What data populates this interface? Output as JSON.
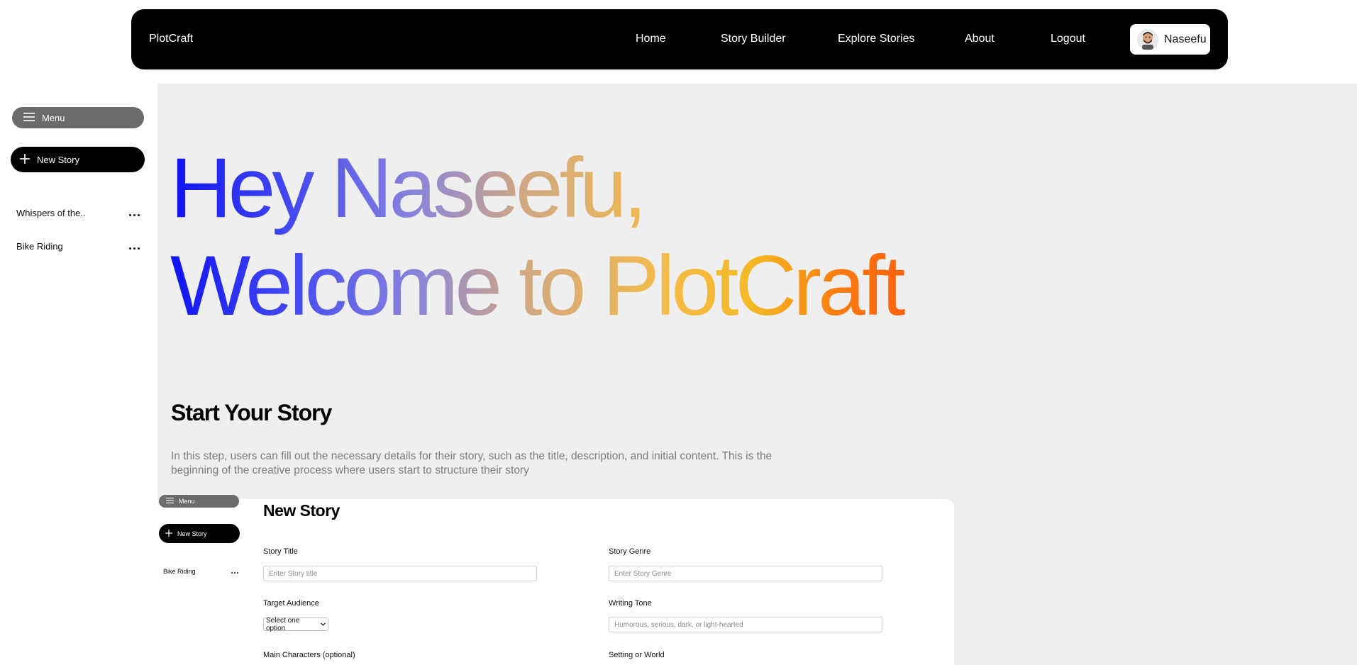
{
  "navbar": {
    "brand": "PlotCraft",
    "links": [
      "Home",
      "Story Builder",
      "Explore Stories",
      "About",
      "Logout"
    ],
    "user_name": "Naseefu"
  },
  "sidebar": {
    "menu_label": "Menu",
    "new_story_label": "New Story",
    "items": [
      {
        "label": "Whispers of the.."
      },
      {
        "label": "Bike Riding"
      }
    ]
  },
  "hero": {
    "line1": "Hey Naseefu,",
    "line2": "Welcome to PlotCraft",
    "gradient_colors": [
      "#0f14f5",
      "#8a84dc",
      "#f3bb4b",
      "#fd5c0c"
    ]
  },
  "start": {
    "title": "Start Your Story",
    "description": "In this step, users can fill out the necessary details for their story, such as the title, description, and initial content. This is the beginning of the creative process where users start to structure their story"
  },
  "form": {
    "mini_sidebar": {
      "menu_label": "Menu",
      "new_story_label": "New Story",
      "items": [
        {
          "label": "Bike Riding"
        }
      ]
    },
    "title": "New Story",
    "fields": {
      "story_title": {
        "label": "Story Title",
        "placeholder": "Enter Story title"
      },
      "story_genre": {
        "label": "Story Genre",
        "placeholder": "Enter Story Genre"
      },
      "target_audience": {
        "label": "Target Audience",
        "selected": "Select one option"
      },
      "writing_tone": {
        "label": "Writing Tone",
        "placeholder": "Humorous, serious, dark, or light-hearted"
      },
      "main_characters": {
        "label": "Main Characters (optional)"
      },
      "setting": {
        "label": "Setting or World"
      }
    }
  },
  "colors": {
    "navbar_bg": "#000000",
    "main_bg": "#efefef",
    "menu_pill_bg": "#6b6b6b",
    "desc_text": "#7c7c7c"
  },
  "icons": [
    "hamburger-icon",
    "plus-icon",
    "more-dots-icon",
    "avatar"
  ]
}
